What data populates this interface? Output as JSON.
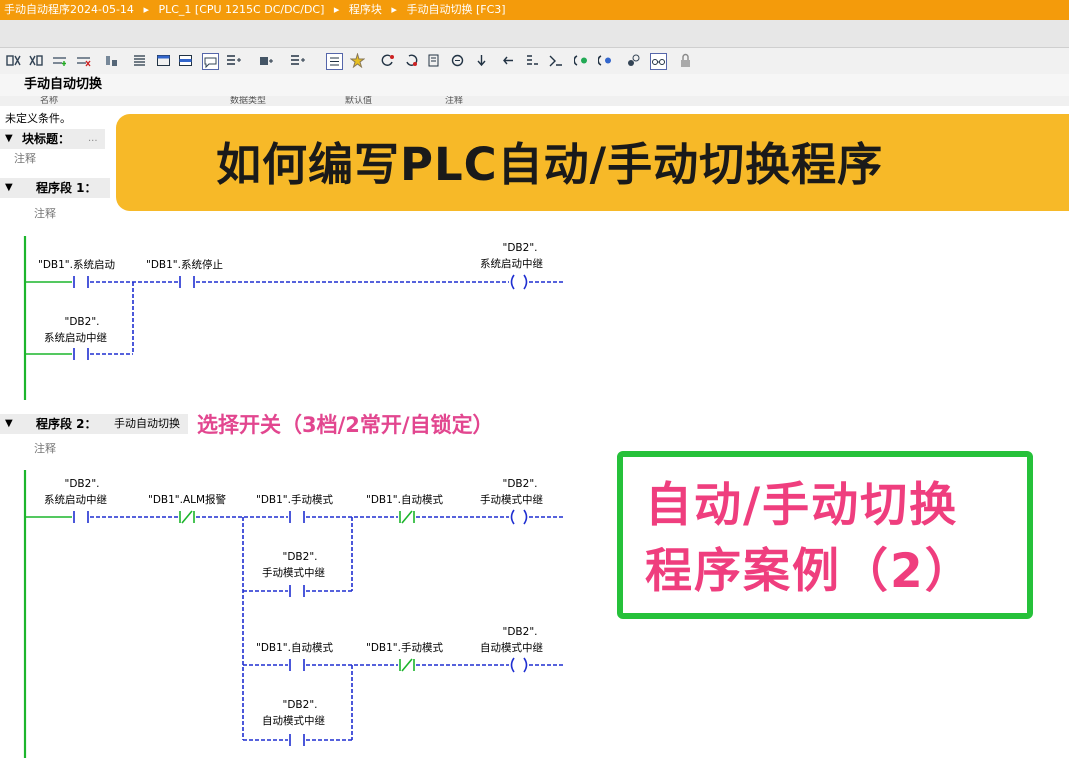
{
  "titlebar": {
    "crumb1": "手动自动程序2024-05-14",
    "crumb2": "PLC_1 [CPU 1215C DC/DC/DC]",
    "crumb3": "程序块",
    "crumb4": "手动自动切换 [FC3]",
    "separator": "▸"
  },
  "block": {
    "name": "手动自动切换",
    "header_col1": "名称",
    "header_col2": "数据类型",
    "header_col3": "默认值",
    "header_col4": "注释",
    "undefined_conditions": "未定义条件。",
    "block_title_label": "块标题：",
    "block_title_ellipsis": "...",
    "block_comment": "注释"
  },
  "banner": {
    "text": "如何编写PLC自动/手动切换程序"
  },
  "network1": {
    "label": "程序段 1：",
    "comment": "注释",
    "contact1": "\"DB1\".系统启动",
    "contact2": "\"DB1\".系统停止",
    "coil_db": "\"DB2\".",
    "coil_name": "系统启动中继",
    "latch_db": "\"DB2\".",
    "latch_name": "系统启动中继"
  },
  "network2": {
    "label": "程序段 2：",
    "title": "手动自动切换",
    "comment": "注释",
    "note": "选择开关（3档/2常开/自锁定）",
    "c1_db": "\"DB2\".",
    "c1_name": "系统启动中继",
    "c2": "\"DB1\".ALM报警",
    "c3": "\"DB1\".手动模式",
    "c4": "\"DB1\".自动模式",
    "coil1_db": "\"DB2\".",
    "coil1_name": "手动模式中继",
    "latch1_db": "\"DB2\".",
    "latch1_name": "手动模式中继",
    "c5": "\"DB1\".自动模式",
    "c6": "\"DB1\".手动模式",
    "coil2_db": "\"DB2\".",
    "coil2_name": "自动模式中继",
    "latch2_db": "\"DB2\".",
    "latch2_name": "自动模式中继"
  },
  "overlay": {
    "line1": "自动/手动切换",
    "line2": "程序案例（2）"
  },
  "colors": {
    "title_orange": "#f49b0b",
    "banner_yellow": "#f7b928",
    "power_rail_green": "#1cb52c",
    "wire_blue": "#1f2fd1",
    "pink_text": "#ef3e7e",
    "green_border": "#26c13a"
  },
  "icons": [
    "compile-icon",
    "download-icon",
    "insert-network-icon",
    "delete-network-icon",
    "contact-no-icon",
    "contact-nc-icon",
    "coil-icon",
    "open-branch-icon",
    "close-branch-icon",
    "monitor-icon",
    "glasses-icon",
    "lock-icon"
  ]
}
